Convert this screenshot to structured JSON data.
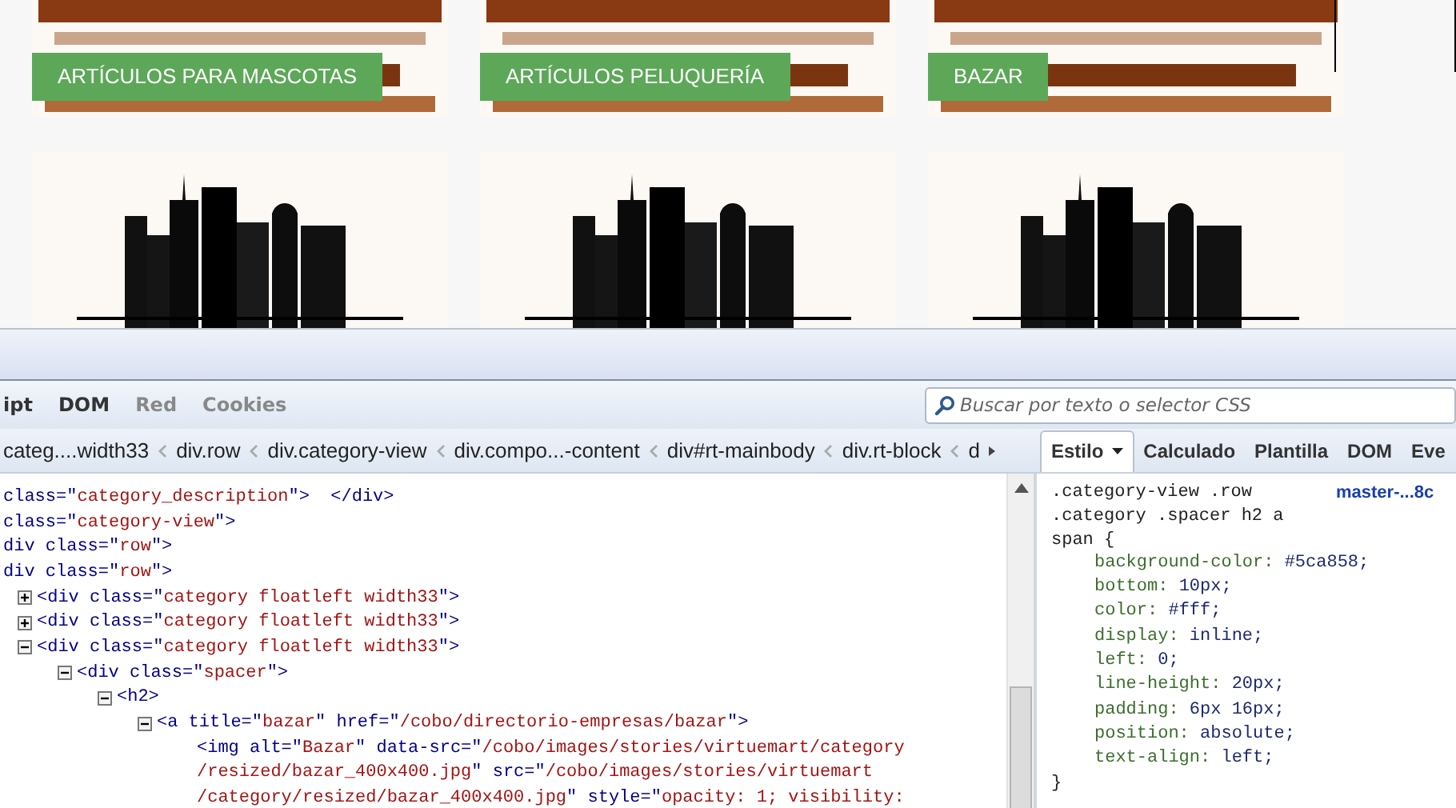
{
  "page": {
    "categories": [
      {
        "kind": "picture",
        "label": "ARTÍCULOS PARA MASCOTAS"
      },
      {
        "kind": "picture",
        "label": "ARTÍCULOS PELUQUERÍA"
      },
      {
        "kind": "picture",
        "label": "BAZAR"
      }
    ]
  },
  "devtools": {
    "panel_tabs": [
      {
        "label": "ipt",
        "disabled": false
      },
      {
        "label": "DOM",
        "disabled": false
      },
      {
        "label": "Red",
        "disabled": true
      },
      {
        "label": "Cookies",
        "disabled": true
      }
    ],
    "search": {
      "placeholder": "Buscar por texto o selector CSS"
    },
    "breadcrumbs": [
      "categ....width33",
      "div.row",
      "div.category-view",
      "div.compo...-content",
      "div#rt-mainbody",
      "div.rt-block",
      "d"
    ],
    "side_tabs": [
      {
        "label": "Estilo",
        "selected": true
      },
      {
        "label": "Calculado",
        "selected": false
      },
      {
        "label": "Plantilla",
        "selected": false
      },
      {
        "label": "DOM",
        "selected": false
      },
      {
        "label": "Eve",
        "selected": false
      }
    ],
    "html_tree": [
      {
        "segments": [
          {
            "kind": "markup",
            "text": "class=\""
          },
          {
            "kind": "value",
            "text": "category_description"
          },
          {
            "kind": "markup",
            "text": "\">  </div>"
          }
        ]
      },
      {
        "segments": [
          {
            "kind": "markup",
            "text": "class=\""
          },
          {
            "kind": "value",
            "text": "category-view"
          },
          {
            "kind": "markup",
            "text": "\">"
          }
        ]
      },
      {
        "segments": [
          {
            "kind": "markup",
            "text": "div class=\""
          },
          {
            "kind": "value",
            "text": "row"
          },
          {
            "kind": "markup",
            "text": "\">"
          }
        ]
      },
      {
        "segments": [
          {
            "kind": "markup",
            "text": "div class=\""
          },
          {
            "kind": "value",
            "text": "row"
          },
          {
            "kind": "markup",
            "text": "\">"
          }
        ],
        "children": [
          {
            "expanded": false,
            "segments": [
              {
                "kind": "markup",
                "text": "<div class=\""
              },
              {
                "kind": "value",
                "text": "category floatleft width33"
              },
              {
                "kind": "markup",
                "text": "\">"
              }
            ]
          },
          {
            "expanded": false,
            "segments": [
              {
                "kind": "markup",
                "text": "<div class=\""
              },
              {
                "kind": "value",
                "text": "category floatleft width33"
              },
              {
                "kind": "markup",
                "text": "\">"
              }
            ]
          },
          {
            "expanded": true,
            "segments": [
              {
                "kind": "markup",
                "text": "<div class=\""
              },
              {
                "kind": "value",
                "text": "category floatleft width33"
              },
              {
                "kind": "markup",
                "text": "\">"
              }
            ],
            "children": [
              {
                "expanded": true,
                "segments": [
                  {
                    "kind": "markup",
                    "text": "<div class=\""
                  },
                  {
                    "kind": "value",
                    "text": "spacer"
                  },
                  {
                    "kind": "markup",
                    "text": "\">"
                  }
                ],
                "children": [
                  {
                    "expanded": true,
                    "segments": [
                      {
                        "kind": "markup",
                        "text": "<h2>"
                      }
                    ],
                    "children": [
                      {
                        "expanded": true,
                        "segments": [
                          {
                            "kind": "markup",
                            "text": "<a title=\""
                          },
                          {
                            "kind": "value",
                            "text": "bazar"
                          },
                          {
                            "kind": "markup",
                            "text": "\" href=\""
                          },
                          {
                            "kind": "value",
                            "text": "/cobo/directorio-empresas/bazar"
                          },
                          {
                            "kind": "markup",
                            "text": "\">"
                          }
                        ],
                        "children": [
                          {
                            "lines": [
                              [
                                {
                                  "kind": "markup",
                                  "text": "<img alt=\""
                                },
                                {
                                  "kind": "value",
                                  "text": "Bazar"
                                },
                                {
                                  "kind": "markup",
                                  "text": "\" data-src=\""
                                },
                                {
                                  "kind": "value",
                                  "text": "/cobo/images/stories/virtuemart/category"
                                }
                              ],
                              [
                                {
                                  "kind": "value",
                                  "text": "/resized/bazar_400x400.jpg"
                                },
                                {
                                  "kind": "markup",
                                  "text": "\" src=\""
                                },
                                {
                                  "kind": "value",
                                  "text": "/cobo/images/stories/virtuemart"
                                }
                              ],
                              [
                                {
                                  "kind": "value",
                                  "text": "/category/resized/bazar_400x400.jpg"
                                },
                                {
                                  "kind": "markup",
                                  "text": "\" style=\""
                                },
                                {
                                  "kind": "value",
                                  "text": "opacity: 1; visibility:"
                                }
                              ]
                            ]
                          }
                        ]
                      }
                    ]
                  }
                ]
              }
            ]
          }
        ]
      }
    ],
    "css_rule": {
      "selector_lines": [
        ".category-view .row",
        ".category .spacer h2 a",
        "span {"
      ],
      "source": "master-...8c",
      "declarations": [
        {
          "property": "background-color:",
          "value": "#5ca858;"
        },
        {
          "property": "bottom:",
          "value": "10px;"
        },
        {
          "property": "color:",
          "value": "#fff;"
        },
        {
          "property": "display:",
          "value": "inline;"
        },
        {
          "property": "left:",
          "value": "0;"
        },
        {
          "property": "line-height:",
          "value": "20px;"
        },
        {
          "property": "padding:",
          "value": "6px 16px;"
        },
        {
          "property": "position:",
          "value": "absolute;"
        },
        {
          "property": "text-align:",
          "value": "left;"
        }
      ],
      "close": "}"
    }
  }
}
